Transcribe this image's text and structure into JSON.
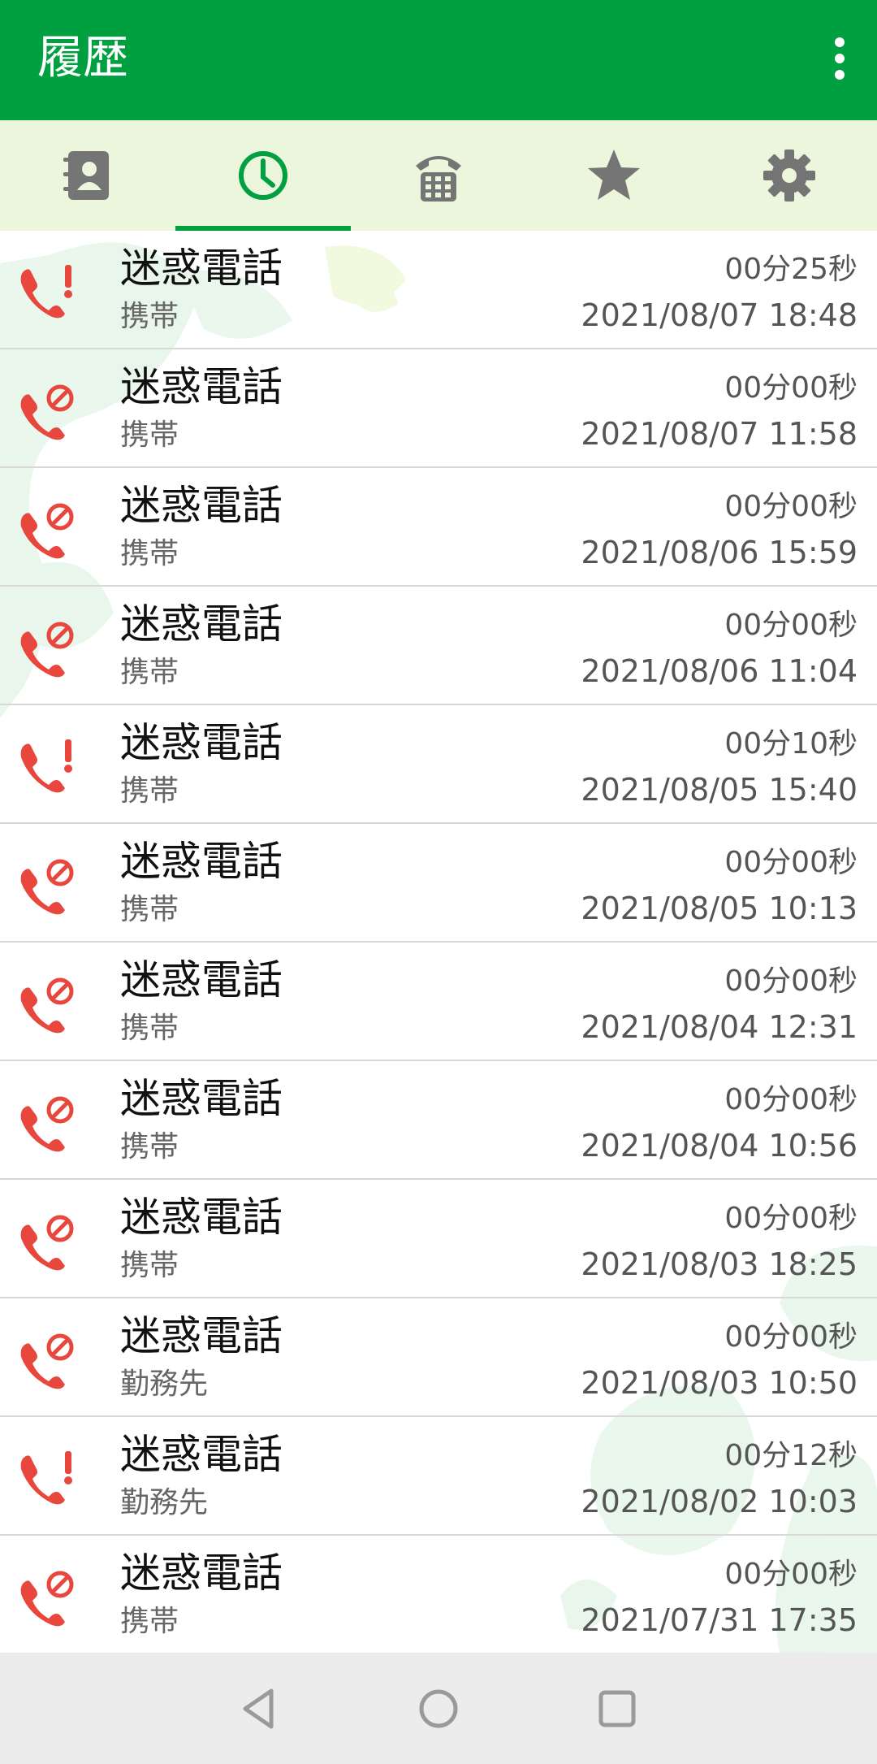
{
  "appbar": {
    "title": "履歴",
    "menu_icon": "more-vert-icon"
  },
  "tabs": [
    {
      "icon": "contacts-icon",
      "active": false
    },
    {
      "icon": "history-clock-icon",
      "active": true
    },
    {
      "icon": "dialpad-phone-icon",
      "active": false
    },
    {
      "icon": "star-icon",
      "active": false
    },
    {
      "icon": "gear-icon",
      "active": false
    }
  ],
  "colors": {
    "primary": "#00a040",
    "tab_bg": "#ecf6dc",
    "call_icon": "#e8473d"
  },
  "calls": [
    {
      "name": "迷惑電話",
      "type": "携帯",
      "duration": "00分25秒",
      "time": "2021/08/07 18:48",
      "icon": "missed-call-warning-icon"
    },
    {
      "name": "迷惑電話",
      "type": "携帯",
      "duration": "00分00秒",
      "time": "2021/08/07 11:58",
      "icon": "blocked-call-icon"
    },
    {
      "name": "迷惑電話",
      "type": "携帯",
      "duration": "00分00秒",
      "time": "2021/08/06 15:59",
      "icon": "blocked-call-icon"
    },
    {
      "name": "迷惑電話",
      "type": "携帯",
      "duration": "00分00秒",
      "time": "2021/08/06 11:04",
      "icon": "blocked-call-icon"
    },
    {
      "name": "迷惑電話",
      "type": "携帯",
      "duration": "00分10秒",
      "time": "2021/08/05 15:40",
      "icon": "missed-call-warning-icon"
    },
    {
      "name": "迷惑電話",
      "type": "携帯",
      "duration": "00分00秒",
      "time": "2021/08/05 10:13",
      "icon": "blocked-call-icon"
    },
    {
      "name": "迷惑電話",
      "type": "携帯",
      "duration": "00分00秒",
      "time": "2021/08/04 12:31",
      "icon": "blocked-call-icon"
    },
    {
      "name": "迷惑電話",
      "type": "携帯",
      "duration": "00分00秒",
      "time": "2021/08/04 10:56",
      "icon": "blocked-call-icon"
    },
    {
      "name": "迷惑電話",
      "type": "携帯",
      "duration": "00分00秒",
      "time": "2021/08/03 18:25",
      "icon": "blocked-call-icon"
    },
    {
      "name": "迷惑電話",
      "type": "勤務先",
      "duration": "00分00秒",
      "time": "2021/08/03 10:50",
      "icon": "blocked-call-icon"
    },
    {
      "name": "迷惑電話",
      "type": "勤務先",
      "duration": "00分12秒",
      "time": "2021/08/02 10:03",
      "icon": "missed-call-warning-icon"
    },
    {
      "name": "迷惑電話",
      "type": "携帯",
      "duration": "00分00秒",
      "time": "2021/07/31 17:35",
      "icon": "blocked-call-icon"
    }
  ],
  "navbar": [
    {
      "icon": "back-triangle-icon"
    },
    {
      "icon": "home-circle-icon"
    },
    {
      "icon": "recents-square-icon"
    }
  ]
}
